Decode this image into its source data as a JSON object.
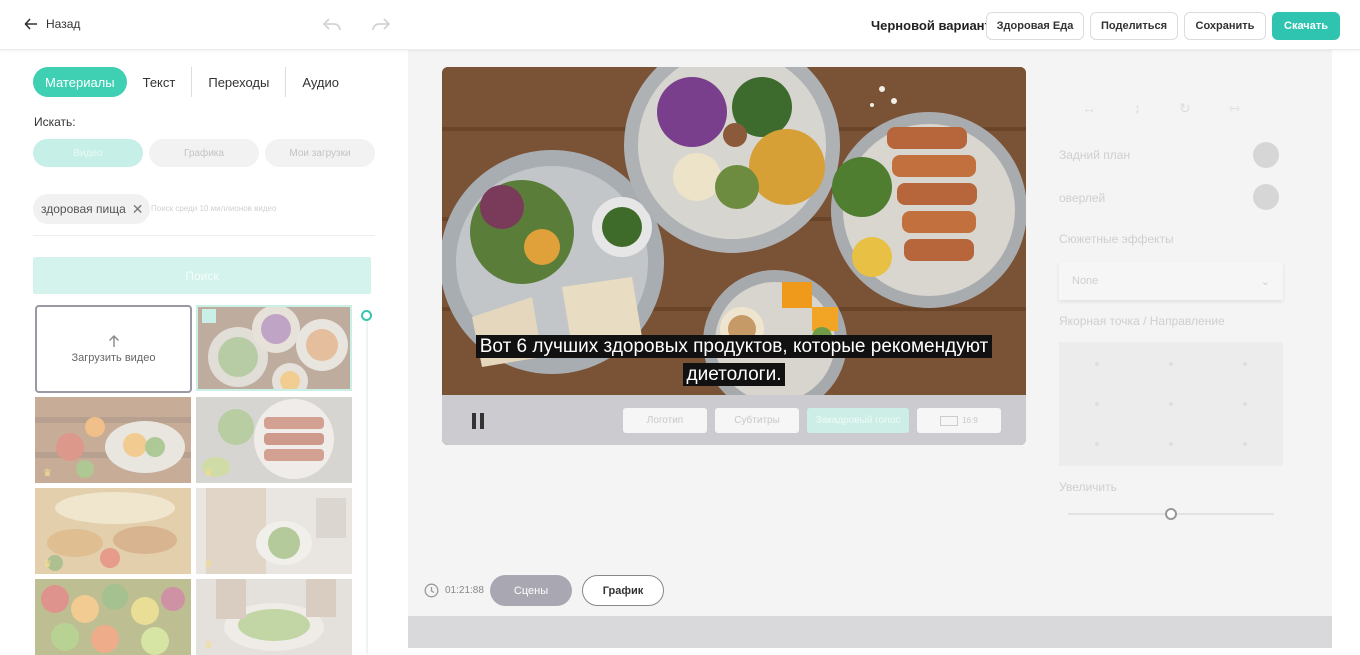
{
  "topbar": {
    "back_label": "Назад",
    "draft_label": "Черновой вариант",
    "project_button": "Здоровая Еда",
    "share_button": "Поделиться",
    "save_button": "Сохранить",
    "download_button": "Скачать"
  },
  "left": {
    "tabs": [
      {
        "label": "Материалы",
        "active": true
      },
      {
        "label": "Текст"
      },
      {
        "label": "Переходы"
      },
      {
        "label": "Аудио"
      }
    ],
    "search_label": "Искать:",
    "media_types": [
      "Видео",
      "Графика",
      "Мои загрузки"
    ],
    "query_chip": "здоровая пища",
    "query_placeholder": "Поиск среди 10 миллионов видео",
    "search_button": "Поиск",
    "upload_label": "Загрузить видео"
  },
  "player": {
    "subtitle": "Вот 6 лучших здоровых продуктов, которые рекомендуют диетологи.",
    "logo_button": "Логотип",
    "subtitles_button": "Субтитры",
    "voiceover_button": "Закадровый голос",
    "ratio_label": "16:9"
  },
  "timeline": {
    "duration": "01:21:88",
    "scenes_button": "Сцены",
    "graph_button": "График"
  },
  "properties": {
    "background_label": "Задний план",
    "overlay_label": "оверлей",
    "effects_label": "Сюжетные эффекты",
    "effects_value": "None",
    "anchor_label": "Якорная точка / Направление",
    "zoom_label": "Увеличить",
    "zoom_level": 0.5
  }
}
